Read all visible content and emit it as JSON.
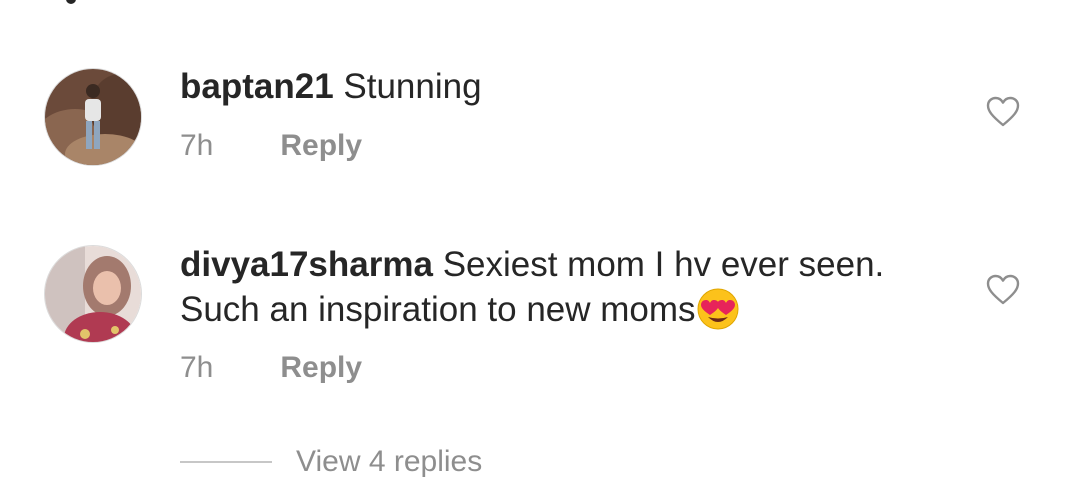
{
  "comments": [
    {
      "username": "baptan21",
      "text": "Stunning",
      "time": "7h",
      "reply_label": "Reply",
      "like_icon": "heart-outline-icon",
      "avatar": "user-avatar-photo"
    },
    {
      "username": "divya17sharma",
      "text": "Sexiest mom I hv ever seen. Such an inspiration to new moms",
      "emoji": "heart-eyes-emoji",
      "time": "7h",
      "reply_label": "Reply",
      "like_icon": "heart-outline-icon",
      "avatar": "user-avatar-photo"
    }
  ],
  "view_replies_label": "View 4 replies",
  "colors": {
    "text": "#262626",
    "muted": "#8e8e8e",
    "divider": "#c7c7c7",
    "background": "#ffffff"
  }
}
